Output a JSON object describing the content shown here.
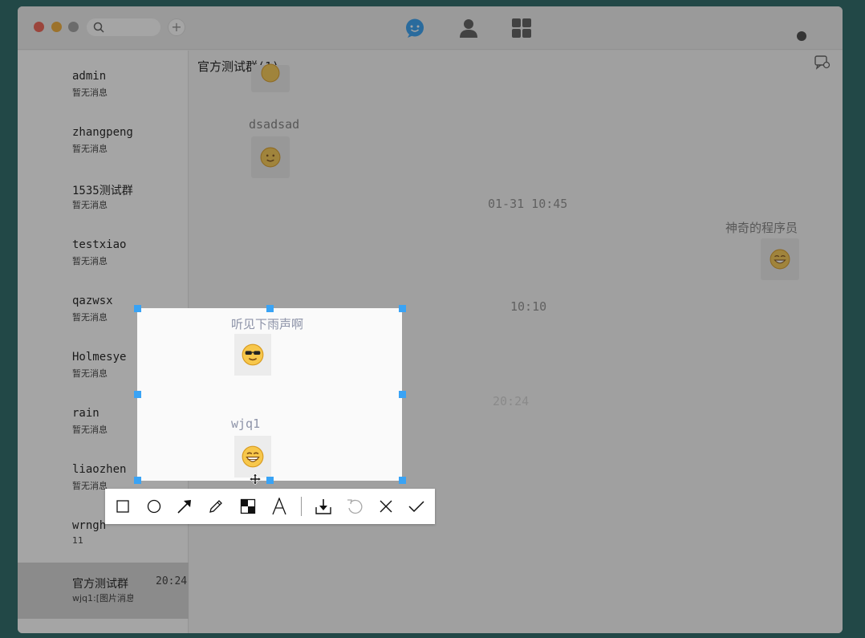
{
  "toolbar_top": {
    "search": {
      "placeholder": ""
    },
    "add_label": "+"
  },
  "conversations": [
    {
      "name": "admin",
      "preview": "暂无消息",
      "time": ""
    },
    {
      "name": "zhangpeng",
      "preview": "暂无消息",
      "time": ""
    },
    {
      "name": "1535测试群",
      "preview": "暂无消息",
      "time": ""
    },
    {
      "name": "testxiao",
      "preview": "暂无消息",
      "time": ""
    },
    {
      "name": "qazwsx",
      "preview": "暂无消息",
      "time": ""
    },
    {
      "name": "Holmesye",
      "preview": "暂无消息",
      "time": ""
    },
    {
      "name": "rain",
      "preview": "暂无消息",
      "time": ""
    },
    {
      "name": "liaozhen",
      "preview": "暂无消息",
      "time": ""
    },
    {
      "name": "wrngh",
      "preview": "11",
      "time": ""
    },
    {
      "name": "官方测试群",
      "preview": "wjq1:[图片消息]",
      "time": "20:24"
    }
  ],
  "chat": {
    "title": "官方测试群(1)",
    "messages": [
      {
        "sender": "dsadsad",
        "emoji": "smile"
      },
      {
        "timestamp": "01-31 10:45"
      },
      {
        "sender": "神奇的程序员",
        "emoji": "grin"
      },
      {
        "timestamp": "10:10"
      },
      {
        "sender": "听见下雨声啊",
        "emoji": "cool"
      },
      {
        "timestamp": "20:24"
      },
      {
        "sender": "wjq1",
        "emoji": "big-grin"
      }
    ]
  },
  "screenshot_tools": [
    {
      "name": "rectangle-tool-icon"
    },
    {
      "name": "ellipse-tool-icon"
    },
    {
      "name": "arrow-tool-icon"
    },
    {
      "name": "pen-tool-icon"
    },
    {
      "name": "mosaic-tool-icon"
    },
    {
      "name": "text-tool-icon"
    },
    {
      "name": "save-tool-icon"
    },
    {
      "name": "undo-tool-icon"
    },
    {
      "name": "cancel-tool-icon"
    },
    {
      "name": "confirm-tool-icon"
    }
  ],
  "colors": {
    "accent": "#39a3f5",
    "active_conversation": "#d2d2d2",
    "background": "#1e5f5e"
  }
}
